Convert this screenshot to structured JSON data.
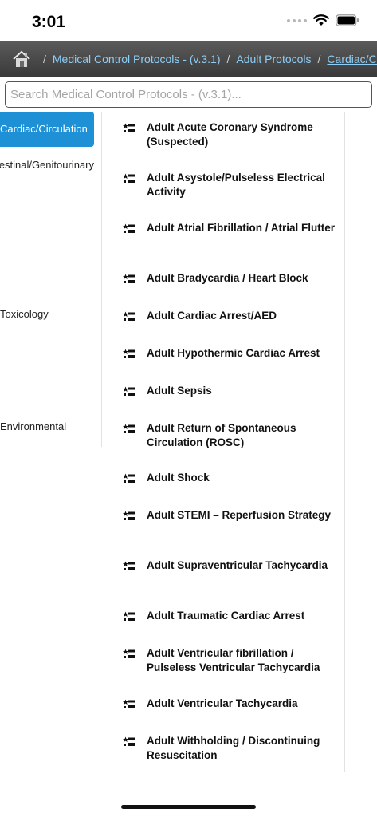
{
  "status": {
    "time": "3:01"
  },
  "breadcrumb": {
    "items": [
      "Medical Control Protocols - (v.3.1)",
      "Adult Protocols",
      "Cardiac/Circulation"
    ],
    "separator": "/"
  },
  "search": {
    "placeholder": "Search Medical Control Protocols - (v.3.1)..."
  },
  "sidebar": {
    "items": [
      {
        "label": "Cardiac/Circulation",
        "active": true
      },
      {
        "label": "Gastrointestinal/Genitourinary",
        "active": false
      },
      {
        "label": "Toxicology",
        "active": false
      },
      {
        "label": "Environmental",
        "active": false
      }
    ]
  },
  "protocols": [
    "Adult Acute Coronary Syndrome (Suspected)",
    "Adult Asystole/Pulseless Electrical Activity",
    "Adult Atrial Fibrillation / Atrial Flutter",
    "Adult Bradycardia / Heart Block",
    "Adult Cardiac Arrest/AED",
    "Adult Hypothermic Cardiac Arrest",
    "Adult Sepsis",
    "Adult Return of Spontaneous Circulation (ROSC)",
    "Adult Shock",
    "Adult STEMI – Reperfusion Strategy",
    "Adult Supraventricular Tachycardia",
    "Adult Traumatic Cardiac Arrest",
    "Adult Ventricular fibrillation / Pulseless Ventricular Tachycardia",
    "Adult Ventricular Tachycardia",
    "Adult Withholding / Discontinuing Resuscitation"
  ],
  "colors": {
    "accent": "#1e91d6",
    "link": "#8ecdf5",
    "navbar": "#4a4a4a"
  },
  "icons": {
    "home": "home-icon",
    "protocol": "protocol-sequence-icon"
  }
}
